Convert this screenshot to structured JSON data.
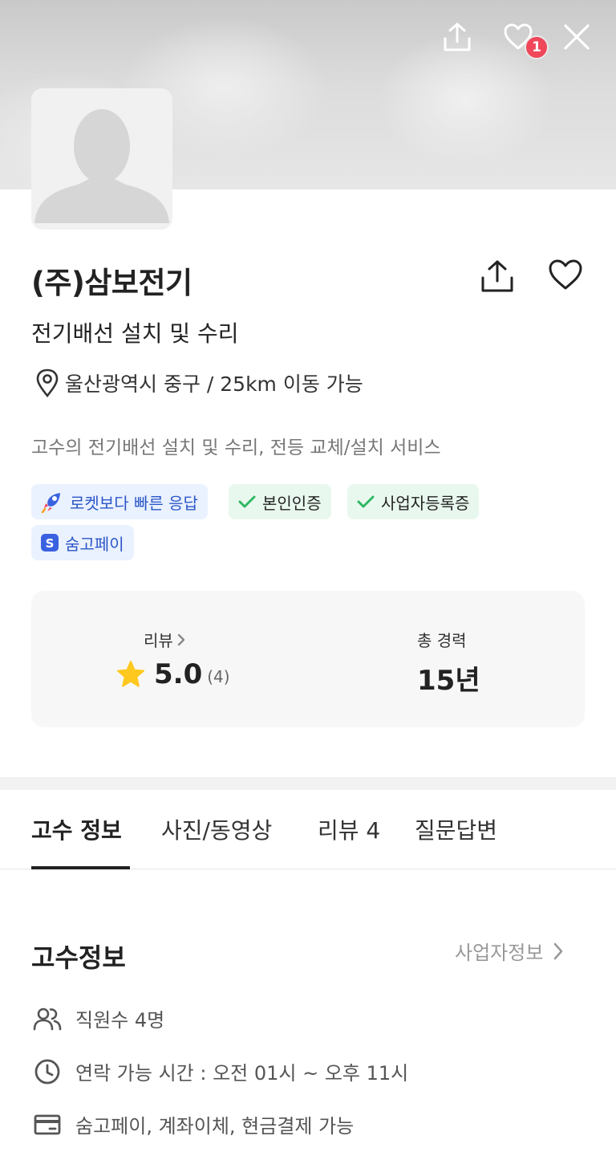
{
  "header": {
    "share_icon": "share-icon",
    "heart_icon": "heart-icon",
    "close_icon": "close-icon",
    "favorite_count": "1"
  },
  "profile": {
    "name": "(주)삼보전기",
    "service": "전기배선 설치 및 수리",
    "location": "울산광역시 중구 / 25km 이동 가능",
    "description": "고수의 전기배선 설치 및 수리, 전등 교체/설치 서비스"
  },
  "badges": [
    {
      "label": "로켓보다 빠른 응답",
      "icon": "rocket-icon",
      "style": "blue"
    },
    {
      "label": "본인인증",
      "icon": "check-icon",
      "style": "green"
    },
    {
      "label": "사업자등록증",
      "icon": "check-icon",
      "style": "green"
    },
    {
      "label": "숨고페이",
      "icon": "soomgo-pay-icon",
      "style": "blue"
    }
  ],
  "stats": {
    "review_label": "리뷰",
    "rating": "5.0",
    "review_count": "(4)",
    "career_label": "총 경력",
    "career_value": "15년"
  },
  "tabs": [
    {
      "label": "고수 정보",
      "active": true
    },
    {
      "label": "사진/동영상",
      "active": false
    },
    {
      "label": "리뷰 4",
      "active": false
    },
    {
      "label": "질문답변",
      "active": false
    }
  ],
  "info": {
    "title": "고수정보",
    "business_link": "사업자정보",
    "rows": [
      {
        "icon": "people-icon",
        "text": "직원수 4명"
      },
      {
        "icon": "clock-icon",
        "text": "연락 가능 시간 : 오전 01시  ~ 오후 11시"
      },
      {
        "icon": "card-icon",
        "text": "숨고페이, 계좌이체, 현금결제 가능"
      }
    ]
  },
  "colors": {
    "accent_blue": "#2b57c7",
    "verify_green": "#2fb862",
    "badge_red": "#f0475a",
    "star_yellow": "#ffc81e"
  }
}
